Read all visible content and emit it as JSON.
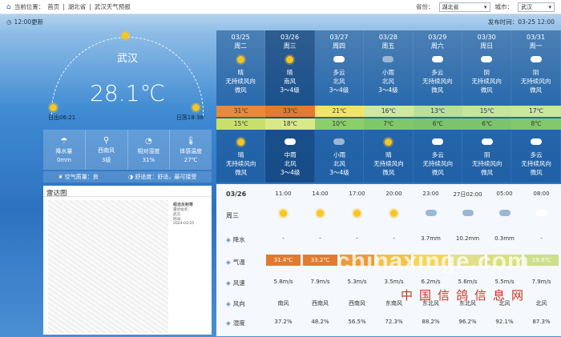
{
  "breadcrumb": {
    "label": "当前位置：",
    "home": "首页",
    "sep1": "|",
    "province": "湖北省",
    "sep2": "|",
    "page": "武汉天气预报"
  },
  "selectors": {
    "province_label": "省份：",
    "province_value": "湖北省",
    "city_label": "城市：",
    "city_value": "武汉"
  },
  "update_time": "12:00更新",
  "publish_time": "发布时间：03-25 12:00",
  "current": {
    "city": "武汉",
    "temp": "28.1℃",
    "sunrise": "日出06:21",
    "sunset": "日落18:38"
  },
  "stats": [
    {
      "icon": "umbrella-icon",
      "label": "降水量",
      "value": "0mm"
    },
    {
      "icon": "wind-icon",
      "label": "西南风",
      "value": "3级"
    },
    {
      "icon": "humidity-icon",
      "label": "相对湿度",
      "value": "31%"
    },
    {
      "icon": "thermometer-icon",
      "label": "体感温度",
      "value": "27℃"
    }
  ],
  "air": {
    "quality": "空气质量：良",
    "comfort": "舒适度：舒适，最可接受"
  },
  "radar": {
    "title": "雷达图",
    "legend_title": "组合反射率",
    "legend_lines": [
      "雷达站点：",
      "武汉",
      "时间：",
      "2024-03-25"
    ]
  },
  "days": [
    {
      "date": "03/25",
      "week": "周二",
      "day_icon": "sun",
      "day_weather": "晴",
      "day_wind_dir": "无持续风向",
      "day_wind_lv": "微风",
      "hi": "31℃",
      "hi_color": "#e88a3a",
      "lo": "15℃",
      "lo_color": "#c8e06a",
      "night_icon": "sun",
      "night_weather": "晴",
      "night_wind_dir": "无持续风向",
      "night_wind_lv": "微风"
    },
    {
      "date": "03/26",
      "week": "周三",
      "day_icon": "sun",
      "day_weather": "晴",
      "day_wind_dir": "南风",
      "day_wind_lv": "3～4级",
      "hi": "33℃",
      "hi_color": "#e27a30",
      "lo": "18℃",
      "lo_color": "#d9e98a",
      "night_icon": "cloud",
      "night_weather": "中雨",
      "night_wind_dir": "北风",
      "night_wind_lv": "3～4级"
    },
    {
      "date": "03/27",
      "week": "周四",
      "day_icon": "cloud",
      "day_weather": "多云",
      "day_wind_dir": "北风",
      "day_wind_lv": "3～4级",
      "hi": "21℃",
      "hi_color": "#f2e36a",
      "lo": "10℃",
      "lo_color": "#8ccf6a",
      "night_icon": "rain",
      "night_weather": "小雨",
      "night_wind_dir": "北风",
      "night_wind_lv": "3～4级"
    },
    {
      "date": "03/28",
      "week": "周五",
      "day_icon": "rain",
      "day_weather": "小雨",
      "day_wind_dir": "北风",
      "day_wind_lv": "3～4级",
      "hi": "16℃",
      "hi_color": "#cfe8a0",
      "lo": "7℃",
      "lo_color": "#7fc86a",
      "night_icon": "sun",
      "night_weather": "晴",
      "night_wind_dir": "无持续风向",
      "night_wind_lv": "微风"
    },
    {
      "date": "03/29",
      "week": "周六",
      "day_icon": "cloud",
      "day_weather": "多云",
      "day_wind_dir": "无持续风向",
      "day_wind_lv": "微风",
      "hi": "13℃",
      "hi_color": "#b9e09a",
      "lo": "6℃",
      "lo_color": "#7cc46c",
      "night_icon": "cloud",
      "night_weather": "多云",
      "night_wind_dir": "无持续风向",
      "night_wind_lv": "微风"
    },
    {
      "date": "03/30",
      "week": "周日",
      "day_icon": "cloud",
      "day_weather": "阴",
      "day_wind_dir": "无持续风向",
      "day_wind_lv": "微风",
      "hi": "15℃",
      "hi_color": "#c5e49c",
      "lo": "6℃",
      "lo_color": "#7cc46c",
      "night_icon": "cloud",
      "night_weather": "阴",
      "night_wind_dir": "无持续风向",
      "night_wind_lv": "微风"
    },
    {
      "date": "03/31",
      "week": "周一",
      "day_icon": "cloud",
      "day_weather": "阴",
      "day_wind_dir": "无持续风向",
      "day_wind_lv": "微风",
      "hi": "17℃",
      "hi_color": "#cbe69e",
      "lo": "8℃",
      "lo_color": "#82c86c",
      "night_icon": "cloud",
      "night_weather": "多云",
      "night_wind_dir": "无持续风向",
      "night_wind_lv": "微风"
    }
  ],
  "hourly": {
    "date": "03/26",
    "week": "周三",
    "times": [
      "11:00",
      "14:00",
      "17:00",
      "20:00",
      "23:00",
      "27日02:00",
      "05:00",
      "08:00"
    ],
    "icons": [
      "sun",
      "sun",
      "sun",
      "sun",
      "rain",
      "rain",
      "rain",
      "cloud"
    ],
    "rows": [
      {
        "icon": "rain-icon",
        "label": "降水",
        "values": [
          "-",
          "-",
          "-",
          "-",
          "3.7mm",
          "10.2mm",
          "0.3mm",
          "-"
        ]
      },
      {
        "icon": "thermometer-icon",
        "label": "气温",
        "values": [
          "31.4℃",
          "33.2℃",
          "",
          "",
          "",
          "",
          "",
          "19.9℃"
        ]
      },
      {
        "icon": "wind-speed-icon",
        "label": "风速",
        "values": [
          "5.8m/s",
          "7.9m/s",
          "5.3m/s",
          "3.5m/s",
          "6.2m/s",
          "5.6m/s",
          "5.5m/s",
          "7.9m/s"
        ]
      },
      {
        "icon": "wind-direction-icon",
        "label": "风向",
        "values": [
          "南风",
          "西南风",
          "西南风",
          "东南风",
          "东北风",
          "东北风",
          "北风",
          "北风"
        ]
      },
      {
        "icon": "humidity-icon",
        "label": "湿度",
        "values": [
          "37.2%",
          "48.2%",
          "56.5%",
          "72.3%",
          "88.2%",
          "96.2%",
          "92.1%",
          "87.3%"
        ]
      }
    ],
    "temp_colors": [
      "#e07a30",
      "#e27a30",
      "#ee9a3a",
      "#f1c34a",
      "#f6d55a",
      "#e0e08a",
      "#d8e07a",
      "#cce08a"
    ]
  },
  "watermark": {
    "main": "chinaxinge.com",
    "sub": "中国信鸽信息网"
  }
}
